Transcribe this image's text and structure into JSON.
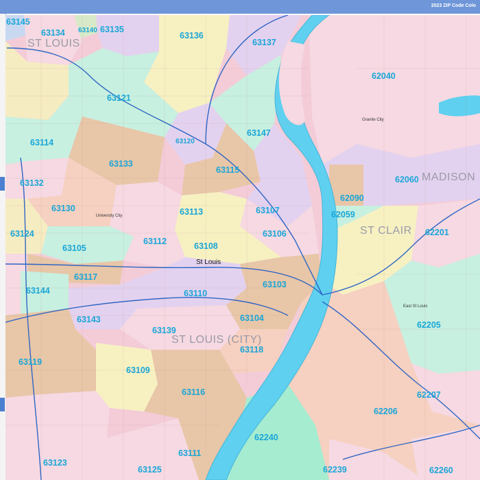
{
  "header": {
    "title": "2023 ZIP Code Colo"
  },
  "colors": {
    "header": "#6e96d8",
    "river": "#5fd0ef",
    "zip_label": "#1aa6d8",
    "interstate": "#2f66c4",
    "region_label": "#9a9aa8"
  },
  "regions": [
    {
      "name": "ST LOUIS"
    },
    {
      "name": "MADISON"
    },
    {
      "name": "ST CLAIR"
    },
    {
      "name": "ST LOUIS (CITY)"
    }
  ],
  "cities": [
    {
      "name": "St Louis"
    },
    {
      "name": "University City"
    },
    {
      "name": "East St Louis"
    },
    {
      "name": "Granite City"
    }
  ],
  "zips": [
    "63145",
    "63134",
    "63140",
    "63135",
    "63136",
    "63137",
    "62040",
    "63121",
    "63147",
    "63114",
    "63120",
    "63133",
    "63115",
    "62060",
    "63132",
    "62090",
    "63130",
    "63107",
    "62059",
    "63113",
    "63106",
    "62201",
    "63124",
    "63112",
    "63108",
    "63105",
    "63117",
    "63103",
    "63144",
    "63110",
    "63104",
    "63143",
    "62205",
    "63139",
    "63118",
    "63119",
    "63109",
    "63116",
    "62207",
    "62206",
    "62240",
    "63123",
    "63111",
    "63125",
    "62239",
    "62260"
  ]
}
